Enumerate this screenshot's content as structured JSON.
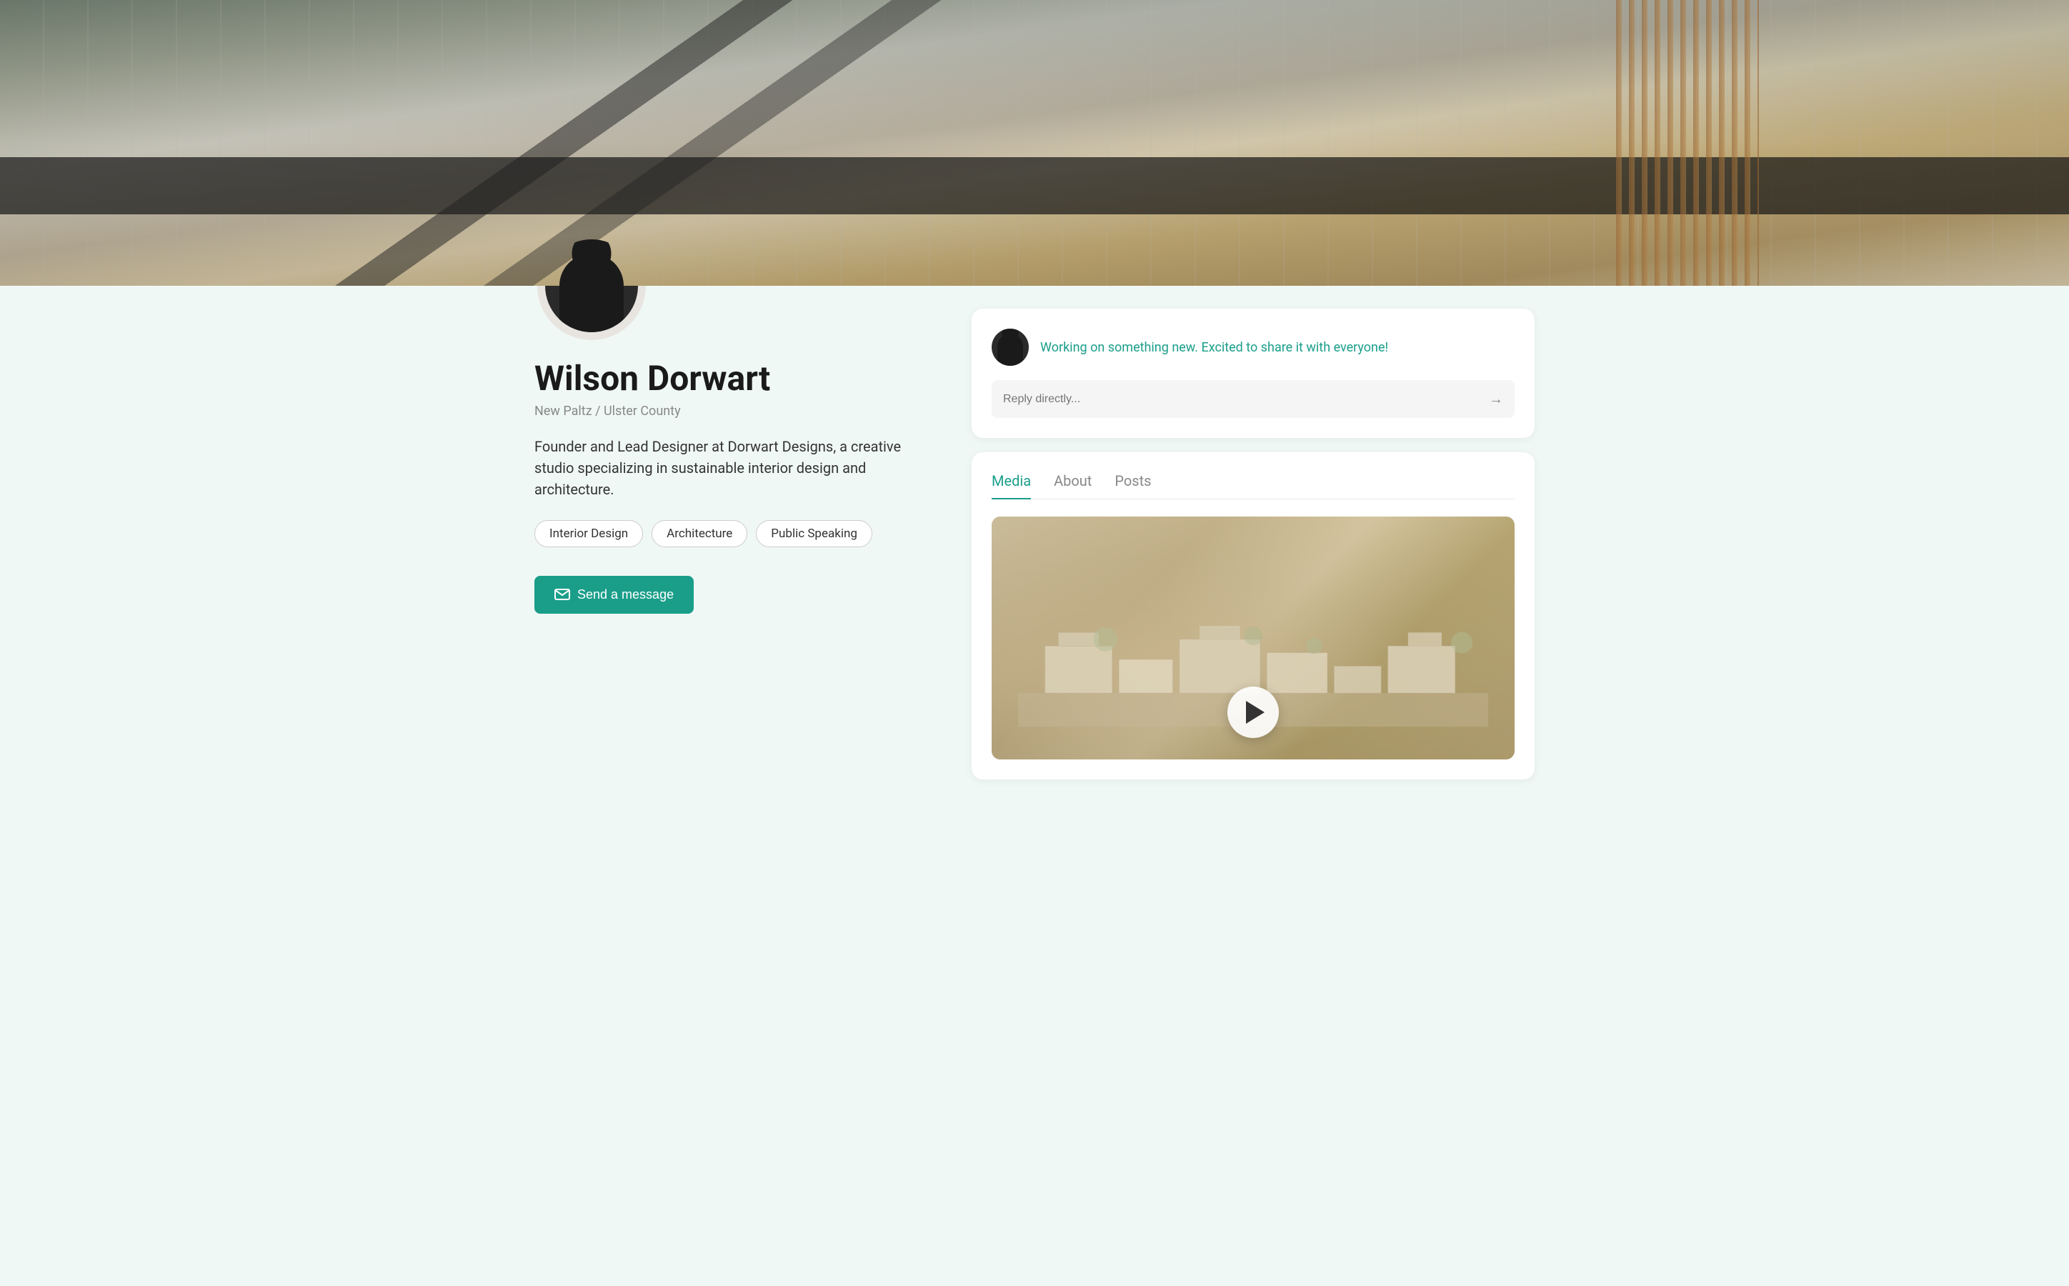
{
  "cover": {
    "alt": "Interior design cover photo showing modern living space"
  },
  "profile": {
    "name": "Wilson Dorwart",
    "city": "New Paltz",
    "region": "Ulster County",
    "bio": "Founder and Lead Designer at Dorwart Designs, a creative studio specializing in sustainable interior design and architecture.",
    "tags": [
      "Interior Design",
      "Architecture",
      "Public Speaking"
    ],
    "send_button": "Send a message"
  },
  "message_card": {
    "message_text": "Working on something new. Excited to share it with everyone!",
    "reply_placeholder": "Reply directly..."
  },
  "media_section": {
    "tabs": [
      {
        "label": "Media",
        "active": true
      },
      {
        "label": "About",
        "active": false
      },
      {
        "label": "Posts",
        "active": false
      }
    ]
  },
  "icons": {
    "mail": "✉",
    "arrow_right": "→",
    "play": "▶"
  }
}
